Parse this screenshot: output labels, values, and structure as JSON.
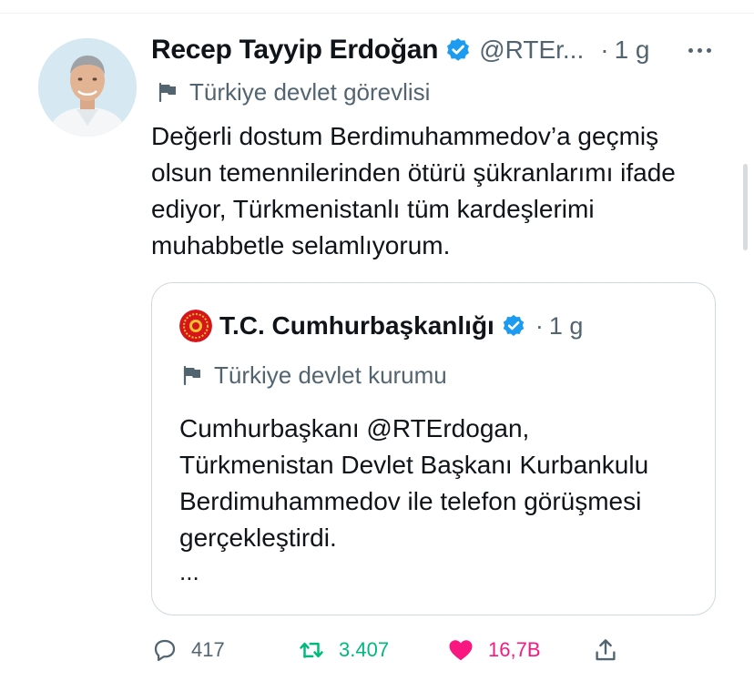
{
  "tweet": {
    "author_name": "Recep Tayyip Erdoğan",
    "handle": "@RTEr...",
    "separator": "·",
    "time": "1 g",
    "label": "Türkiye devlet görevlisi",
    "text": "Değerli dostum Berdimuhammedov’a geçmiş olsun temennilerinden ötürü şükranlarımı ifade ediyor, Türkmenistanlı tüm kardeşlerimi muhabbetle selamlıyorum.",
    "avatar_icon": "profile-photo",
    "more_icon": "more-dots-icon"
  },
  "quote": {
    "author_name": "T.C. Cumhurbaşkanlığı",
    "separator": "·",
    "time": "1 g",
    "label": "Türkiye devlet kurumu",
    "text": "Cumhurbaşkanı @RTErdogan, Türkmenistan Devlet Başkanı Kurbankulu Berdimuhammedov ile telefon görüşmesi gerçekleştirdi.",
    "ellipsis": "...",
    "avatar_icon": "presidential-seal-icon"
  },
  "actions": {
    "reply_count": "417",
    "retweet_count": "3.407",
    "like_count": "16,7B"
  },
  "colors": {
    "verified_blue": "#1d9bf0",
    "secondary_text": "#536471",
    "retweet_green": "#00ba7c",
    "like_pink": "#f91880",
    "seal_red": "#d7141a",
    "seal_gold": "#f2c230"
  }
}
